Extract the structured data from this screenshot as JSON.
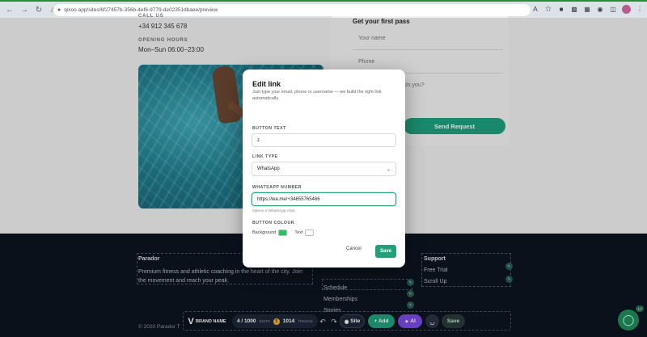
{
  "browser": {
    "url": "qixoo.app/sites/6f27457b-356b-4ef6-9779-de02351dbaee/preview",
    "back_icon": "arrow-left-icon",
    "forward_icon": "arrow-right-icon",
    "reload_icon": "reload-icon",
    "home_icon": "home-icon"
  },
  "contact": {
    "call_label": "CALL US",
    "phone": "+34 912 345 678",
    "hours_label": "OPENING HOURS",
    "hours": "Mon–Sun 06:00–23:00"
  },
  "form": {
    "title": "Get your first pass",
    "name_placeholder": "Your name",
    "phone_placeholder": "Phone",
    "question_placeholder": "Which pass interests you?",
    "send_label": "Send Request"
  },
  "footer": {
    "brand_heading": "Parador",
    "brand_text": "Premium fitness and athletic coaching in the heart of the city. Join the movement and reach your peak.",
    "links": [
      "Schedule",
      "Memberships",
      "Stories"
    ],
    "support_heading": "Support",
    "support_links": [
      "Free Trial",
      "Scroll Up"
    ],
    "copyright": "© 2020 Parador T"
  },
  "toolbar": {
    "brand": "BRAND NAME",
    "edits": "4 / 1000",
    "edits_label": "EDITS",
    "tokens": "1014",
    "tokens_label": "TOKENS",
    "site_label": "Site",
    "add_label": "+ Add",
    "ai_label": "AI",
    "save_label": "Save"
  },
  "fab_badge": "17",
  "modal": {
    "title": "Edit link",
    "subtitle": "Just type your email, phone or username — we build the right link automatically.",
    "button_text_label": "BUTTON TEXT",
    "button_text_value": "z",
    "link_type_label": "LINK TYPE",
    "link_type_value": "WhatsApp",
    "whatsapp_label": "WHATSAPP NUMBER",
    "whatsapp_value": "https://wa.me/+34655765466",
    "whatsapp_help": "Opens a WhatsApp chat.",
    "colour_label": "BUTTON COLOUR",
    "background_label": "Background",
    "text_label": "Text",
    "cancel_label": "Cancel",
    "save_label": "Save"
  },
  "colors": {
    "accent": "#21a07a",
    "background_swatch": "#22c55e",
    "text_swatch": "#ffffff",
    "footer_bg": "#0d1420"
  }
}
